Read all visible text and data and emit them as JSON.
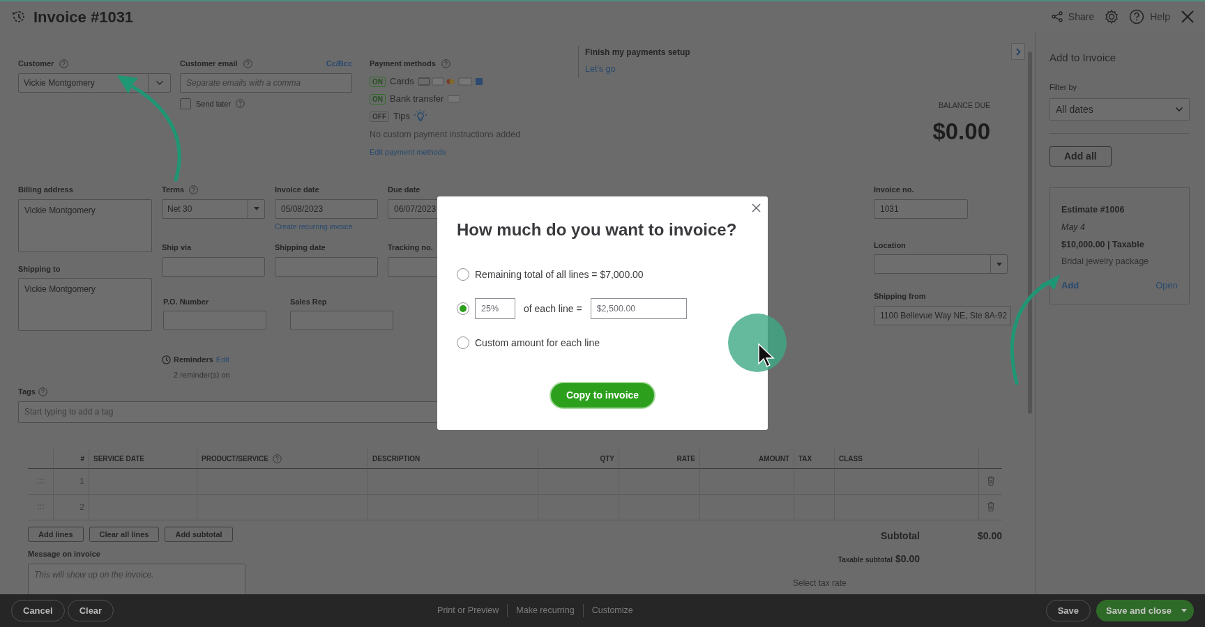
{
  "header": {
    "title": "Invoice #1031",
    "actions": [
      {
        "kind": "share",
        "label": "Share"
      },
      {
        "kind": "settings"
      },
      {
        "kind": "help",
        "label": "Help"
      },
      {
        "kind": "close"
      }
    ]
  },
  "customer": {
    "label": "Customer",
    "value": "Vickie Montgomery"
  },
  "customer_email": {
    "label": "Customer email",
    "cc_link": "Cc/Bcc",
    "placeholder": "Separate emails with a comma",
    "send_later": {
      "label": "Send later",
      "checked": false
    }
  },
  "payment_methods": {
    "label": "Payment methods",
    "methods": [
      {
        "kind": "cards",
        "badge": "ON",
        "on": true,
        "label": "Cards"
      },
      {
        "kind": "bank",
        "badge": "ON",
        "on": true,
        "label": "Bank transfer"
      },
      {
        "kind": "tips",
        "badge": "OFF",
        "on": false,
        "label": "Tips"
      }
    ],
    "note": "No custom payment instructions added",
    "link": "Edit payment methods"
  },
  "payments_setup": {
    "title": "Finish my payments setup",
    "link": "Let's go"
  },
  "balance": {
    "label": "BALANCE DUE",
    "amount": "$0.00"
  },
  "billing_address": {
    "label": "Billing address",
    "value": "Vickie Montgomery"
  },
  "shipping_to": {
    "label": "Shipping to",
    "value": "Vickie Montgomery"
  },
  "field_rows": [
    [
      {
        "label": "Terms",
        "value": "Net 30",
        "kind": "select",
        "help": true
      },
      {
        "label": "Invoice date",
        "value": "05/08/2023",
        "kind": "text",
        "link": "Create recurring invoice"
      },
      {
        "label": "Due date",
        "value": "06/07/2023",
        "kind": "text"
      }
    ],
    [
      {
        "label": "Ship via",
        "kind": "text"
      },
      {
        "label": "Shipping date",
        "kind": "text"
      },
      {
        "label": "Tracking no.",
        "kind": "text"
      }
    ],
    [
      {
        "label": "P.O. Number",
        "kind": "text"
      },
      {
        "label": "Sales Rep",
        "kind": "text"
      }
    ]
  ],
  "reminders": {
    "label": "Reminders",
    "link": "Edit",
    "note": "2 reminder(s) on"
  },
  "right_fields": [
    {
      "label": "Invoice no.",
      "value": "1031",
      "kind": "text"
    },
    {
      "label": "Location",
      "kind": "select"
    },
    {
      "label": "Shipping from",
      "value": "1100 Bellevue Way NE, Ste 8A-92",
      "kind": "text"
    }
  ],
  "tags": {
    "label": "Tags",
    "placeholder": "Start typing to add a tag"
  },
  "table": {
    "columns": [
      {
        "label": "#",
        "kind": "numeric"
      },
      {
        "label": "SERVICE DATE",
        "kind": "text"
      },
      {
        "label": "PRODUCT/SERVICE",
        "kind": "text",
        "help": true
      },
      {
        "label": "DESCRIPTION",
        "kind": "text"
      },
      {
        "label": "QTY",
        "kind": "numeric"
      },
      {
        "label": "RATE",
        "kind": "numeric"
      },
      {
        "label": "AMOUNT",
        "kind": "numeric"
      },
      {
        "label": "TAX",
        "kind": "text"
      },
      {
        "label": "CLASS",
        "kind": "text"
      }
    ],
    "rows": [
      {
        "number": "1"
      },
      {
        "number": "2"
      }
    ]
  },
  "line_buttons": [
    "Add lines",
    "Clear all lines",
    "Add subtotal"
  ],
  "totals": {
    "subtotal_label": "Subtotal",
    "subtotal": "$0.00",
    "taxable_label": "Taxable subtotal",
    "taxable": "$0.00"
  },
  "message": {
    "label": "Message on invoice",
    "placeholder": "This will show up on the invoice."
  },
  "tax_rate": {
    "label": "Select tax rate"
  },
  "footer": {
    "left": [
      "Cancel",
      "Clear"
    ],
    "center": [
      "Print or Preview",
      "Make recurring",
      "Customize"
    ],
    "right": [
      {
        "label": "Save",
        "kind": "secondary"
      },
      {
        "label": "Save and close",
        "kind": "primary"
      }
    ]
  },
  "side_panel": {
    "title": "Add to Invoice",
    "filter_label": "Filter by",
    "filter_value": "All dates",
    "add_all": "Add all",
    "estimates": [
      {
        "title": "Estimate #1006",
        "date": "May 4",
        "amount": "$10,000.00 | Taxable",
        "description": "Bridal jewelry package",
        "add": "Add",
        "open": "Open"
      }
    ]
  },
  "dialog": {
    "title": "How much do you want to invoice?",
    "options": [
      {
        "kind": "total",
        "label": "Remaining total of all lines = $7,000.00",
        "selected": false
      },
      {
        "kind": "percent",
        "percent": "25%",
        "label": "of each line =",
        "amount": "$2,500.00",
        "selected": true
      },
      {
        "kind": "custom",
        "label": "Custom amount for each line",
        "selected": false
      }
    ],
    "button": "Copy to invoice"
  }
}
